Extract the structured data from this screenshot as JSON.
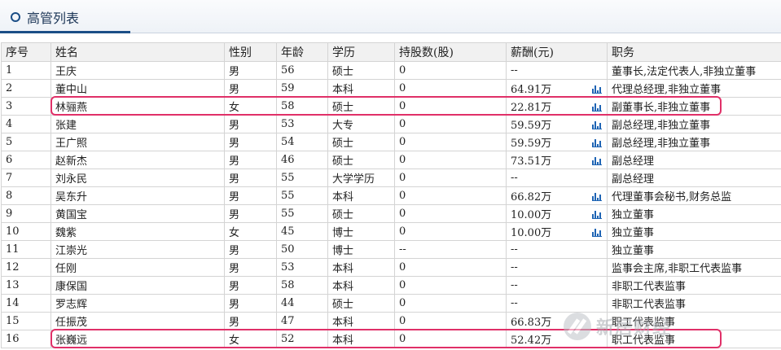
{
  "header": {
    "title": "高管列表"
  },
  "table": {
    "columns": [
      "序号",
      "姓名",
      "性别",
      "年龄",
      "学历",
      "持股数(股)",
      "薪酬(元)",
      "职务"
    ],
    "rows": [
      {
        "no": "1",
        "name": "王庆",
        "gender": "男",
        "age": "56",
        "edu": "硕士",
        "shares": "0",
        "salary": "--",
        "chart": false,
        "title": "董事长,法定代表人,非独立董事"
      },
      {
        "no": "2",
        "name": "董中山",
        "gender": "男",
        "age": "59",
        "edu": "本科",
        "shares": "0",
        "salary": "64.91万",
        "chart": true,
        "title": "代理总经理,非独立董事"
      },
      {
        "no": "3",
        "name": "林骊燕",
        "gender": "女",
        "age": "58",
        "edu": "硕士",
        "shares": "0",
        "salary": "22.81万",
        "chart": true,
        "title": "副董事长,非独立董事"
      },
      {
        "no": "4",
        "name": "张建",
        "gender": "男",
        "age": "53",
        "edu": "大专",
        "shares": "0",
        "salary": "59.59万",
        "chart": true,
        "title": "副总经理,非独立董事"
      },
      {
        "no": "5",
        "name": "王广照",
        "gender": "男",
        "age": "54",
        "edu": "硕士",
        "shares": "0",
        "salary": "59.59万",
        "chart": true,
        "title": "副总经理,非独立董事"
      },
      {
        "no": "6",
        "name": "赵新杰",
        "gender": "男",
        "age": "46",
        "edu": "硕士",
        "shares": "0",
        "salary": "73.51万",
        "chart": true,
        "title": "副总经理"
      },
      {
        "no": "7",
        "name": "刘永民",
        "gender": "男",
        "age": "55",
        "edu": "大学学历",
        "shares": "0",
        "salary": "--",
        "chart": false,
        "title": "副总经理"
      },
      {
        "no": "8",
        "name": "吴东升",
        "gender": "男",
        "age": "55",
        "edu": "本科",
        "shares": "0",
        "salary": "66.82万",
        "chart": true,
        "title": "代理董事会秘书,财务总监"
      },
      {
        "no": "9",
        "name": "黄国宝",
        "gender": "男",
        "age": "55",
        "edu": "硕士",
        "shares": "0",
        "salary": "10.00万",
        "chart": true,
        "title": "独立董事"
      },
      {
        "no": "10",
        "name": "魏紫",
        "gender": "女",
        "age": "45",
        "edu": "博士",
        "shares": "0",
        "salary": "10.00万",
        "chart": true,
        "title": "独立董事"
      },
      {
        "no": "11",
        "name": "江崇光",
        "gender": "男",
        "age": "50",
        "edu": "博士",
        "shares": "--",
        "salary": "--",
        "chart": false,
        "title": "独立董事"
      },
      {
        "no": "12",
        "name": "任刚",
        "gender": "男",
        "age": "53",
        "edu": "本科",
        "shares": "0",
        "salary": "--",
        "chart": false,
        "title": "监事会主席,非职工代表监事"
      },
      {
        "no": "13",
        "name": "康保国",
        "gender": "男",
        "age": "58",
        "edu": "本科",
        "shares": "0",
        "salary": "--",
        "chart": false,
        "title": "非职工代表监事"
      },
      {
        "no": "14",
        "name": "罗志辉",
        "gender": "男",
        "age": "44",
        "edu": "硕士",
        "shares": "0",
        "salary": "--",
        "chart": false,
        "title": "非职工代表监事"
      },
      {
        "no": "15",
        "name": "任振茂",
        "gender": "男",
        "age": "47",
        "edu": "本科",
        "shares": "0",
        "salary": "66.83万",
        "chart": false,
        "title": "职工代表监事"
      },
      {
        "no": "16",
        "name": "张巍远",
        "gender": "女",
        "age": "52",
        "edu": "本科",
        "shares": "0",
        "salary": "52.42万",
        "chart": false,
        "title": "职工代表监事"
      }
    ]
  },
  "highlight_color": "#e03068",
  "accent_color": "#1b4e86",
  "chart_icon": "bar-chart-icon",
  "watermark": {
    "text": "新居财经",
    "icon": "xueqiu-logo-icon"
  }
}
